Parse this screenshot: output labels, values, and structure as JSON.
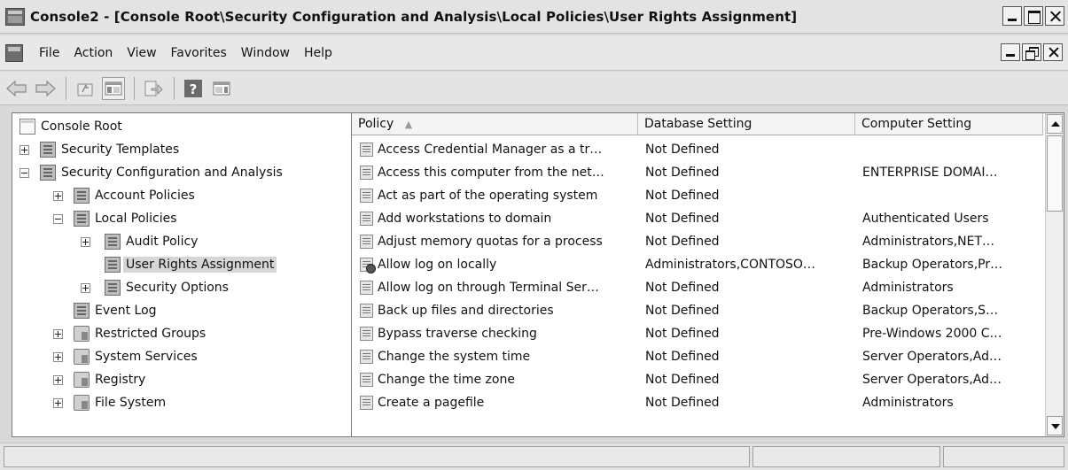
{
  "window": {
    "title": "Console2 - [Console Root\\Security Configuration and Analysis\\Local Policies\\User Rights Assignment]"
  },
  "menubar": {
    "items": [
      "File",
      "Action",
      "View",
      "Favorites",
      "Window",
      "Help"
    ]
  },
  "toolbar": {
    "buttons": [
      "back-arrow-icon",
      "forward-arrow-icon",
      "up-folder-icon",
      "show-hide-tree-icon",
      "export-list-icon",
      "help-icon",
      "show-hide-action-pane-icon"
    ]
  },
  "tree": {
    "root": "Console Root",
    "items": [
      {
        "label": "Security Templates",
        "expander": "plus",
        "icon": "doc"
      },
      {
        "label": "Security Configuration and Analysis",
        "expander": "minus",
        "icon": "doc"
      },
      {
        "label": "Account Policies",
        "expander": "plus",
        "icon": "doc"
      },
      {
        "label": "Local Policies",
        "expander": "minus",
        "icon": "doc"
      },
      {
        "label": "Audit Policy",
        "expander": "plus",
        "icon": "doc"
      },
      {
        "label": "User Rights Assignment",
        "expander": "none",
        "icon": "doc",
        "selected": true
      },
      {
        "label": "Security Options",
        "expander": "plus",
        "icon": "doc"
      },
      {
        "label": "Event Log",
        "expander": "none",
        "icon": "doc"
      },
      {
        "label": "Restricted Groups",
        "expander": "plus",
        "icon": "folder"
      },
      {
        "label": "System Services",
        "expander": "plus",
        "icon": "folder"
      },
      {
        "label": "Registry",
        "expander": "plus",
        "icon": "folder"
      },
      {
        "label": "File System",
        "expander": "plus",
        "icon": "folder"
      }
    ]
  },
  "table": {
    "columns": [
      "Policy",
      "Database Setting",
      "Computer Setting"
    ],
    "sort_indicator": "▲",
    "rows": [
      {
        "policy": "Access Credential Manager as a tr…",
        "database": "Not Defined",
        "computer": "",
        "icon": "policy"
      },
      {
        "policy": "Access this computer from the net…",
        "database": "Not Defined",
        "computer": "ENTERPRISE DOMAI…",
        "icon": "policy"
      },
      {
        "policy": "Act as part of the operating system",
        "database": "Not Defined",
        "computer": "",
        "icon": "policy"
      },
      {
        "policy": "Add workstations to domain",
        "database": "Not Defined",
        "computer": "Authenticated Users",
        "icon": "policy"
      },
      {
        "policy": "Adjust memory quotas for a process",
        "database": "Not Defined",
        "computer": "Administrators,NET…",
        "icon": "policy"
      },
      {
        "policy": "Allow log on locally",
        "database": "Administrators,CONTOSO…",
        "computer": "Backup Operators,Pr…",
        "icon": "policy-mismatch"
      },
      {
        "policy": "Allow log on through Terminal Ser…",
        "database": "Not Defined",
        "computer": "Administrators",
        "icon": "policy"
      },
      {
        "policy": "Back up files and directories",
        "database": "Not Defined",
        "computer": "Backup Operators,S…",
        "icon": "policy"
      },
      {
        "policy": "Bypass traverse checking",
        "database": "Not Defined",
        "computer": "Pre-Windows 2000 C…",
        "icon": "policy"
      },
      {
        "policy": "Change the system time",
        "database": "Not Defined",
        "computer": "Server Operators,Ad…",
        "icon": "policy"
      },
      {
        "policy": "Change the time zone",
        "database": "Not Defined",
        "computer": "Server Operators,Ad…",
        "icon": "policy"
      },
      {
        "policy": "Create a pagefile",
        "database": "Not Defined",
        "computer": "Administrators",
        "icon": "policy"
      }
    ]
  },
  "statusbar": {
    "panels": [
      "",
      "",
      ""
    ]
  }
}
